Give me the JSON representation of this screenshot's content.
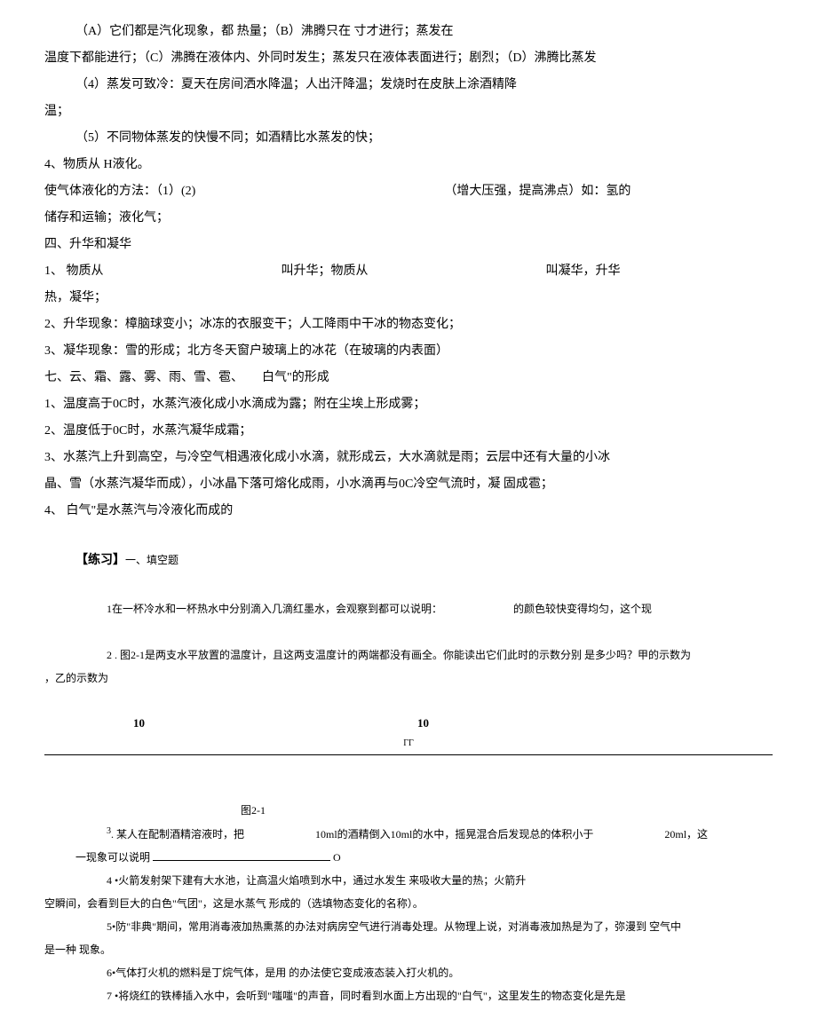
{
  "lines": {
    "l1": "（A）它们都是汽化现象，都 热量；（B）沸腾只在 寸才进行；蒸发在",
    "l2": "温度下都能进行；（C）沸腾在液体内、外同时发生；蒸发只在液体表面进行；剧烈；（D）沸腾比蒸发",
    "l3": "（4）蒸发可致冷：夏天在房间洒水降温；人出汗降温；发烧时在皮肤上涂酒精降",
    "l4": "温；",
    "l5": "（5）不同物体蒸发的快慢不同；如酒精比水蒸发的快；",
    "l6": "4、物质从 H液化。",
    "l7a": "使气体液化的方法：（1）(2)",
    "l7b": "（增大压强，提高沸点）如：氢的",
    "l8": "储存和运输；液化气；",
    "l9": "四、升华和凝华",
    "l10a": "1、 物质从",
    "l10b": "叫升华；物质从",
    "l10c": "叫凝华，升华",
    "l11": "热，凝华；",
    "l12": "2、升华现象：樟脑球变小；冰冻的衣服变干；人工降雨中干冰的物态变化；",
    "l13": "3、凝华现象：雪的形成；北方冬天窗户玻璃上的冰花（在玻璃的内表面）",
    "l14": "七、云、霜、露、雾、雨、雪、雹、　　白气\"的形成",
    "l15": "1、温度高于0C时，水蒸汽液化成小水滴成为露；附在尘埃上形成雾；",
    "l16": "2、温度低于0C时，水蒸汽凝华成霜；",
    "l17": "3、水蒸汽上升到高空，与冷空气相遇液化成小水滴，就形成云，大水滴就是雨；云层中还有大量的小冰",
    "l18": "晶、雪（水蒸汽凝华而成），小冰晶下落可熔化成雨，小水滴再与0C冷空气流时，凝 固成雹；",
    "l19": "4、 白气\"是水蒸汽与冷液化而成的",
    "ex_label": "【练习】",
    "ex_type": "一、填空题",
    "q1a": "1在一杯冷水和一杯热水中分别滴入几滴红墨水，会观察到都可以说明：",
    "q1b": "的颜色较快变得均匀，这个现",
    "q2": "2 . 图2-1是两支水平放置的温度计，且这两支温度计的两端都没有画全。你能读出它们此时的示数分别 是多少吗？甲的示数为",
    "q2_end": "，乙的示数为",
    "num_l": "10",
    "num_r": "10",
    "tc": "ГГ",
    "caption": "图2-1",
    "q3a": "3",
    "q3b": ". 某人在配制酒精溶液时，把",
    "q3c": "10ml的酒精倒入10ml的水中，摇晃混合后发现总的体积小于",
    "q3d": "20ml，这",
    "q3e": "一现象可以说明",
    "q3f": "O",
    "q4a": "4 •火箭发射架下建有大水池，让高温火焰喷到水中，通过水发生 来吸收大量的热；火箭升",
    "q4b": "空瞬间，会看到巨大的白色\"气团\"，这是水蒸气 形成的（选填物态变化的名称）。",
    "q5a": "5•防\"非典\"期间，常用消毒液加热熏蒸的办法对病房空气进行消毒处理。从物理上说，对消毒液加热是为了，弥漫到 空气中",
    "q5b": "是一种 现象。",
    "q6": "6•气体打火机的燃料是丁烷气体，是用 的办法使它变成液态装入打火机的。",
    "q7": "7 •将烧红的铁棒插入水中，会听到\"嗤嗤\"的声音，同时看到水面上方出现的\"白气\"，这里发生的物态变化是先是"
  }
}
